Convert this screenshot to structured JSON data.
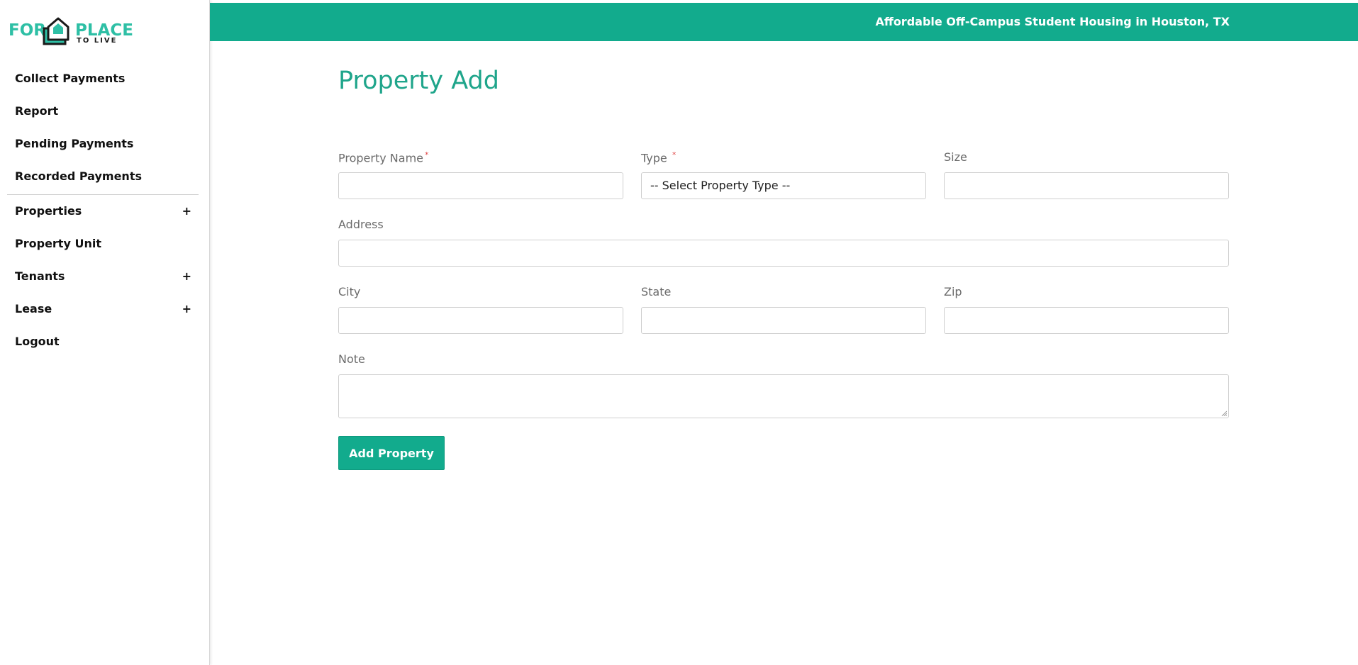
{
  "brand": {
    "logo_for": "FOR",
    "logo_place": "PLACE",
    "logo_tolive": "TO LIVE",
    "accent_color": "#12ab8d",
    "title_color": "#1fa58b"
  },
  "header": {
    "tagline": "Affordable Off-Campus Student Housing in Houston, TX"
  },
  "sidebar": {
    "items": [
      {
        "label": "Collect Payments",
        "expandable": false
      },
      {
        "label": "Report",
        "expandable": false
      },
      {
        "label": "Pending Payments",
        "expandable": false
      },
      {
        "label": "Recorded Payments",
        "expandable": false
      },
      {
        "label": "Properties",
        "expandable": true,
        "icon": "plus-icon"
      },
      {
        "label": "Property Unit",
        "expandable": false
      },
      {
        "label": "Tenants",
        "expandable": true,
        "icon": "plus-icon"
      },
      {
        "label": "Lease",
        "expandable": true,
        "icon": "plus-icon"
      },
      {
        "label": "Logout",
        "expandable": false
      }
    ],
    "expand_symbol": "+"
  },
  "main": {
    "title": "Property Add",
    "form": {
      "property_name": {
        "label": "Property Name",
        "required_mark": "*",
        "value": ""
      },
      "type": {
        "label": "Type",
        "required_mark": "*",
        "selected": "-- Select Property Type --"
      },
      "size": {
        "label": "Size",
        "value": ""
      },
      "address": {
        "label": "Address",
        "value": ""
      },
      "city": {
        "label": "City",
        "value": ""
      },
      "state": {
        "label": "State",
        "value": ""
      },
      "zip": {
        "label": "Zip",
        "value": ""
      },
      "note": {
        "label": "Note",
        "value": ""
      },
      "submit_label": "Add Property"
    }
  }
}
